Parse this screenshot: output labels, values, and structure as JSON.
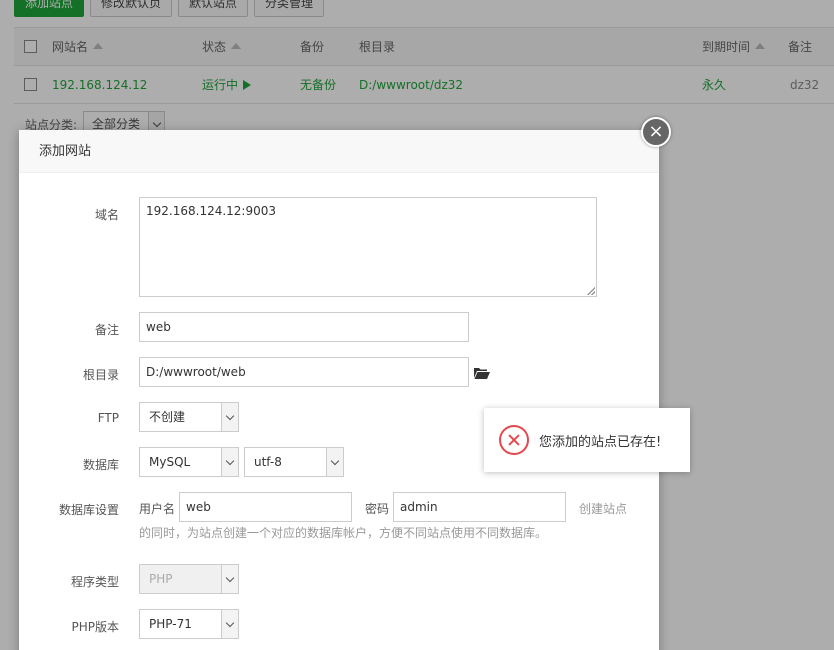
{
  "toolbar": {
    "add_site": "添加站点",
    "modify_default_page": "修改默认页",
    "default_site": "默认站点",
    "category_manage": "分类管理"
  },
  "table": {
    "headers": {
      "site_name": "网站名",
      "status": "状态",
      "backup": "备份",
      "root_dir": "根目录",
      "expire": "到期时间",
      "note": "备注"
    },
    "rows": [
      {
        "site_name": "192.168.124.12",
        "status": "运行中",
        "backup": "无备份",
        "root_dir": "D:/wwwroot/dz32",
        "expire": "永久",
        "note": "dz32"
      }
    ]
  },
  "filter": {
    "label": "站点分类:",
    "value": "全部分类"
  },
  "dialog": {
    "title": "添加网站",
    "close_glyph": "×",
    "domain_label": "域名",
    "domain_value": "192.168.124.12:9003",
    "note_label": "备注",
    "note_value": "web",
    "root_label": "根目录",
    "root_value": "D:/wwwroot/web",
    "ftp_label": "FTP",
    "ftp_value": "不创建",
    "db_label": "数据库",
    "db_value": "MySQL",
    "db_charset": "utf-8",
    "db_settings_label": "数据库设置",
    "db_user_label": "用户名",
    "db_user_value": "web",
    "db_pass_label": "密码",
    "db_pass_value": "admin",
    "db_hint_tail": "创建站点",
    "db_hint": "的同时，为站点创建一个对应的数据库帐户，方便不同站点使用不同数据库。",
    "program_type_label": "程序类型",
    "program_type_value": "PHP",
    "php_version_label": "PHP版本",
    "php_version_value": "PHP-71"
  },
  "toast": {
    "message": "您添加的站点已存在!"
  },
  "colors": {
    "accent": "#20a53a",
    "error": "#e5484d"
  }
}
